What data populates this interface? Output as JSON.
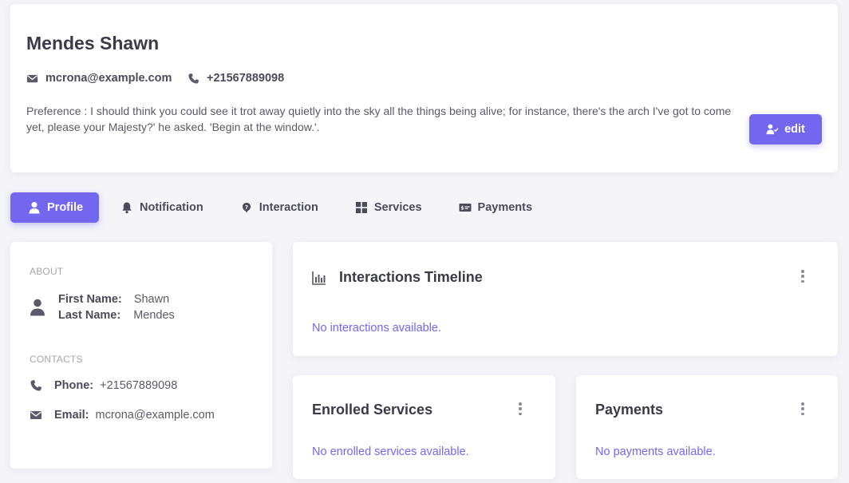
{
  "header": {
    "name": "Mendes Shawn",
    "email": "mcrona@example.com",
    "phone": "+21567889098",
    "preference": "Preference : I should think you could see it trot away quietly into the sky all the things being alive; for instance, there's the arch I've got to come yet, please your Majesty?' he asked. 'Begin at the window.'.",
    "edit_label": "edit"
  },
  "tabs": [
    {
      "label": "Profile",
      "icon": "user-icon",
      "active": true
    },
    {
      "label": "Notification",
      "icon": "bell-icon",
      "active": false
    },
    {
      "label": "Interaction",
      "icon": "question-icon",
      "active": false
    },
    {
      "label": "Services",
      "icon": "grid-icon",
      "active": false
    },
    {
      "label": "Payments",
      "icon": "payment-card-icon",
      "active": false
    }
  ],
  "about": {
    "section_label": "ABOUT",
    "first_name_label": "First Name:",
    "first_name": "Shawn",
    "last_name_label": "Last Name:",
    "last_name": "Mendes",
    "contacts_label": "CONTACTS",
    "phone_label": "Phone:",
    "phone": "+21567889098",
    "email_label": "Email:",
    "email": "mcrona@example.com"
  },
  "timeline": {
    "title": "Interactions Timeline",
    "empty": "No interactions available."
  },
  "services": {
    "title": "Enrolled Services",
    "empty": "No enrolled services available."
  },
  "payments": {
    "title": "Payments",
    "empty": "No payments available."
  },
  "colors": {
    "primary": "#7367f0",
    "background": "#f4f4f9",
    "text": "#4b4b5a"
  }
}
